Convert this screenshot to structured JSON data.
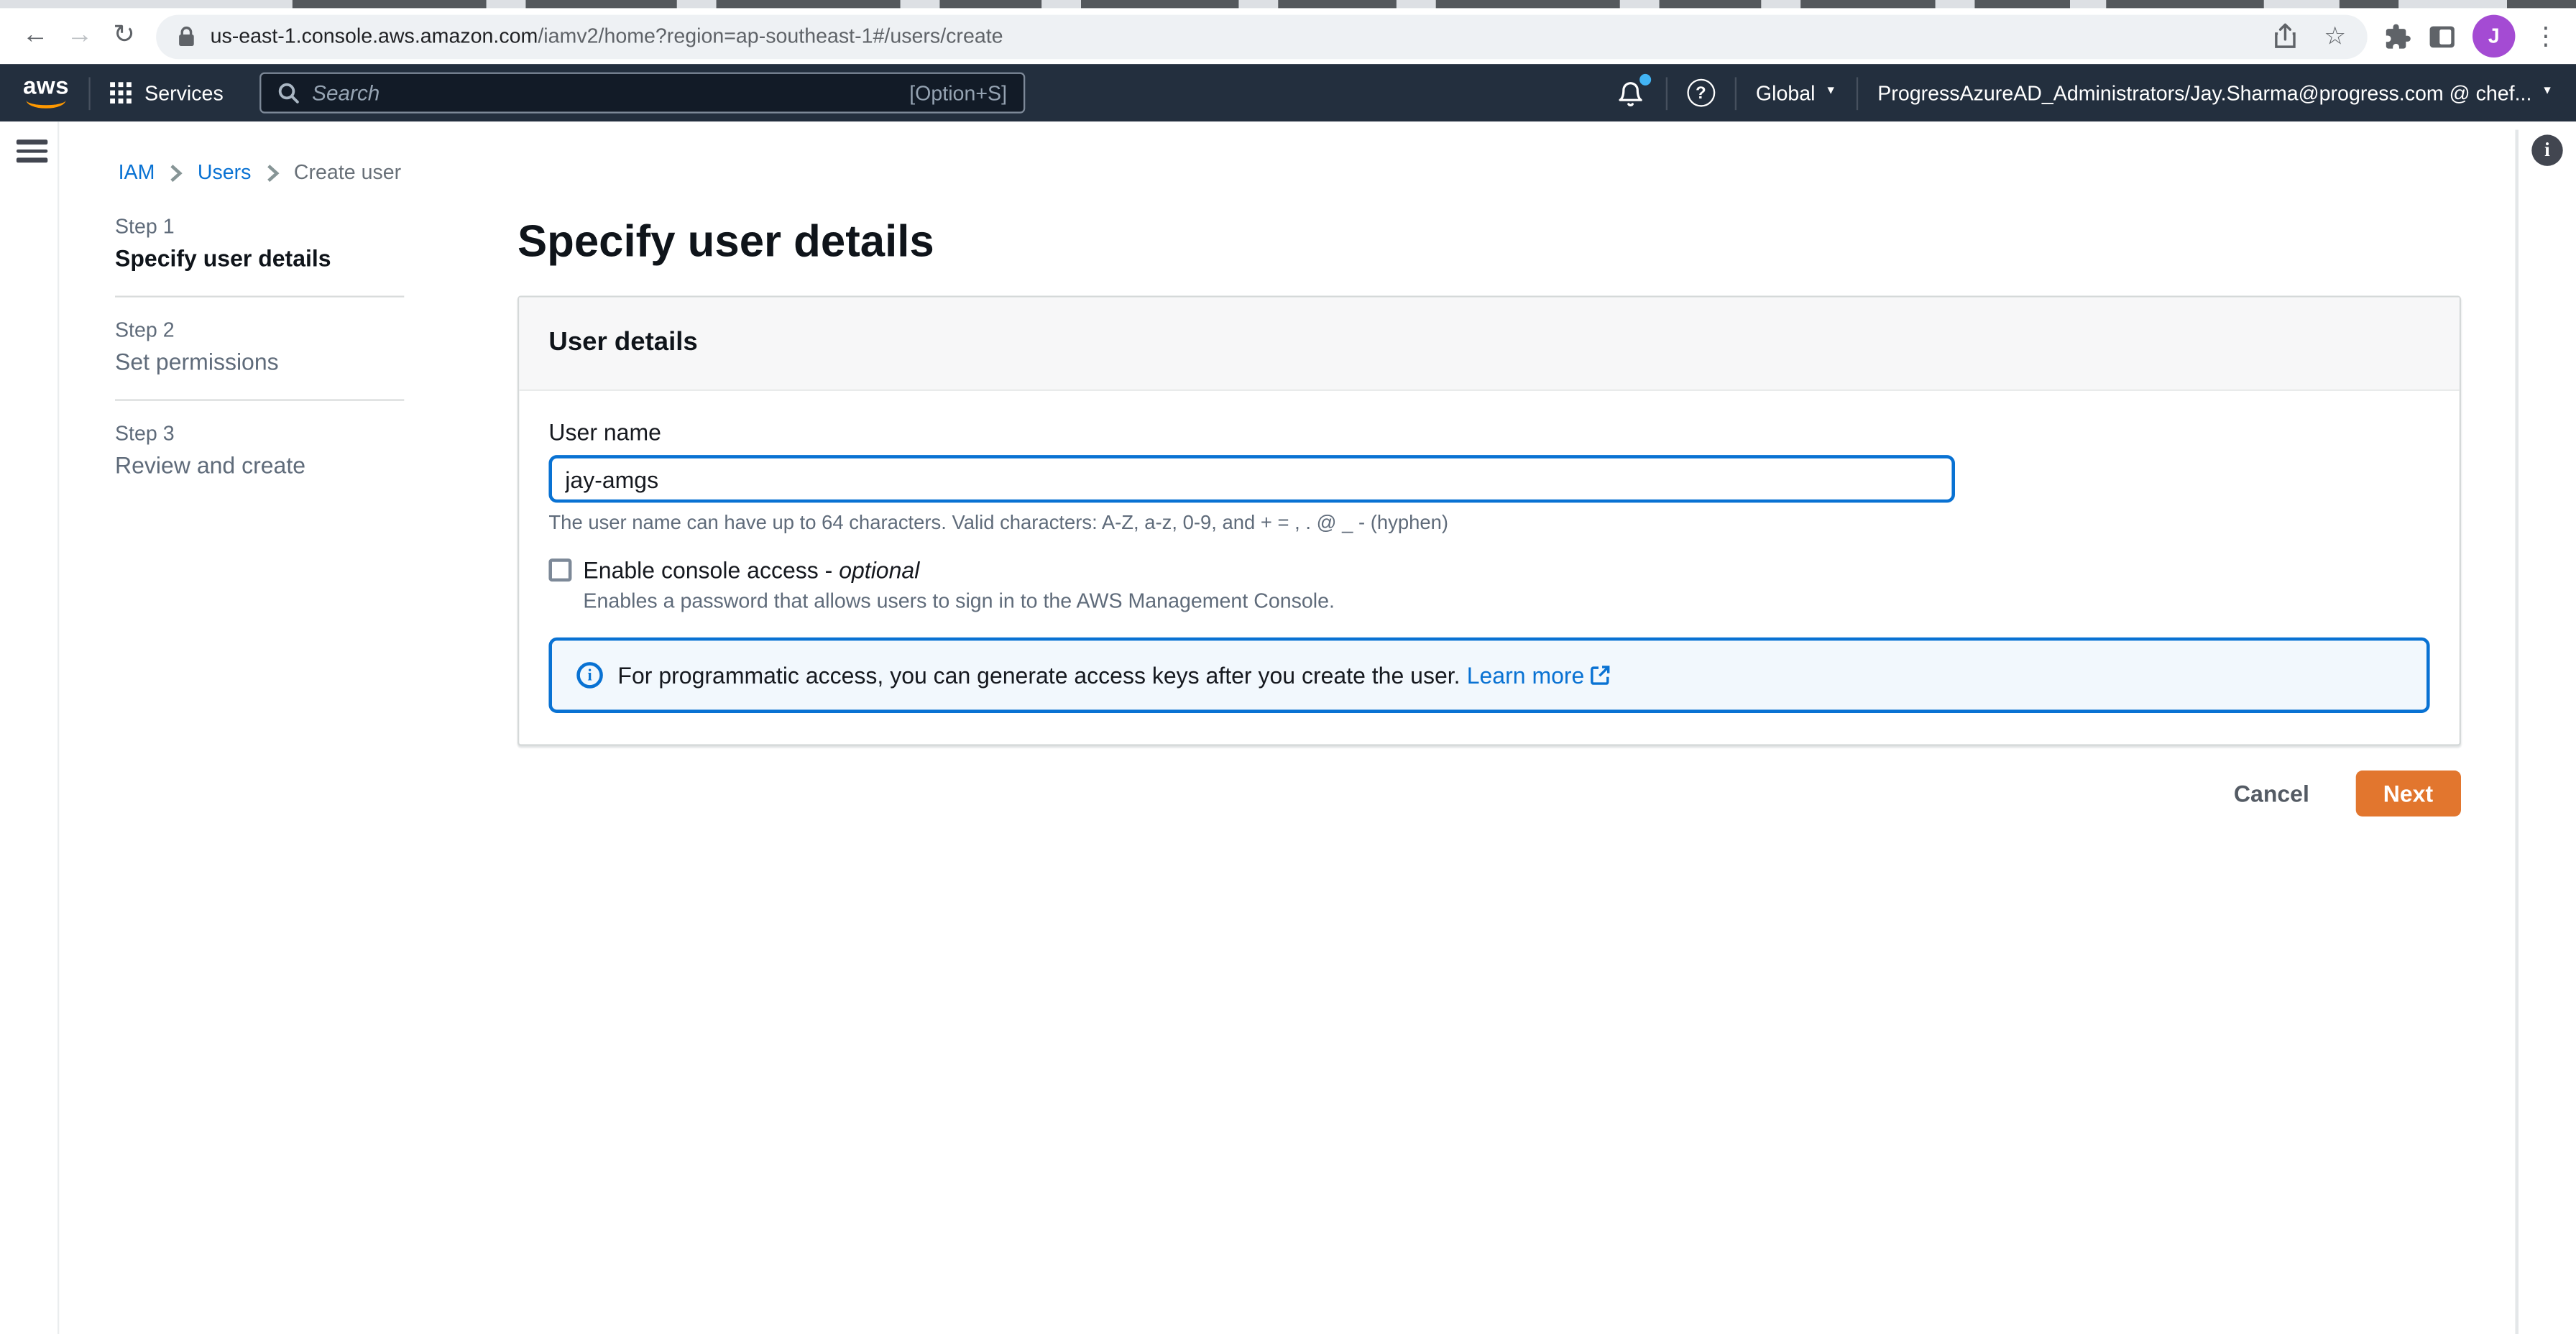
{
  "browser": {
    "omnibox": {
      "host": "us-east-1.console.aws.amazon.com",
      "path": "/iamv2/home?region=ap-southeast-1#/users/create"
    },
    "avatar_letter": "J"
  },
  "aws_nav": {
    "logo": "aws",
    "services": "Services",
    "search_placeholder": "Search",
    "search_shortcut": "[Option+S]",
    "region": "Global",
    "account": "ProgressAzureAD_Administrators/Jay.Sharma@progress.com @ chef..."
  },
  "breadcrumb": {
    "iam": "IAM",
    "users": "Users",
    "current": "Create user"
  },
  "steps": {
    "step1_label": "Step 1",
    "step1_title": "Specify user details",
    "step2_label": "Step 2",
    "step2_title": "Set permissions",
    "step3_label": "Step 3",
    "step3_title": "Review and create"
  },
  "content": {
    "page_title": "Specify user details",
    "panel_title": "User details",
    "username_label": "User name",
    "username_value": "jay-amgs",
    "username_hint": "The user name can have up to 64 characters. Valid characters: A-Z, a-z, 0-9, and + = , . @ _ - (hyphen)",
    "console_label": "Enable console access -",
    "console_optional": "optional",
    "console_desc": "Enables a password that allows users to sign in to the AWS Management Console.",
    "alert_text": "For programmatic access, you can generate access keys after you create the user.",
    "alert_link": "Learn more",
    "cancel": "Cancel",
    "next": "Next"
  },
  "icons": {
    "back": "←",
    "forward": "→",
    "reload": "↻",
    "star": "☆",
    "kebab": "⋮",
    "help": "?",
    "info": "i",
    "caret_down": "▼"
  },
  "colors": {
    "nav_bg": "#232f3e",
    "accent_blue": "#0972d3",
    "primary_orange": "#e2762e",
    "alert_bg": "#f2f8fd"
  }
}
